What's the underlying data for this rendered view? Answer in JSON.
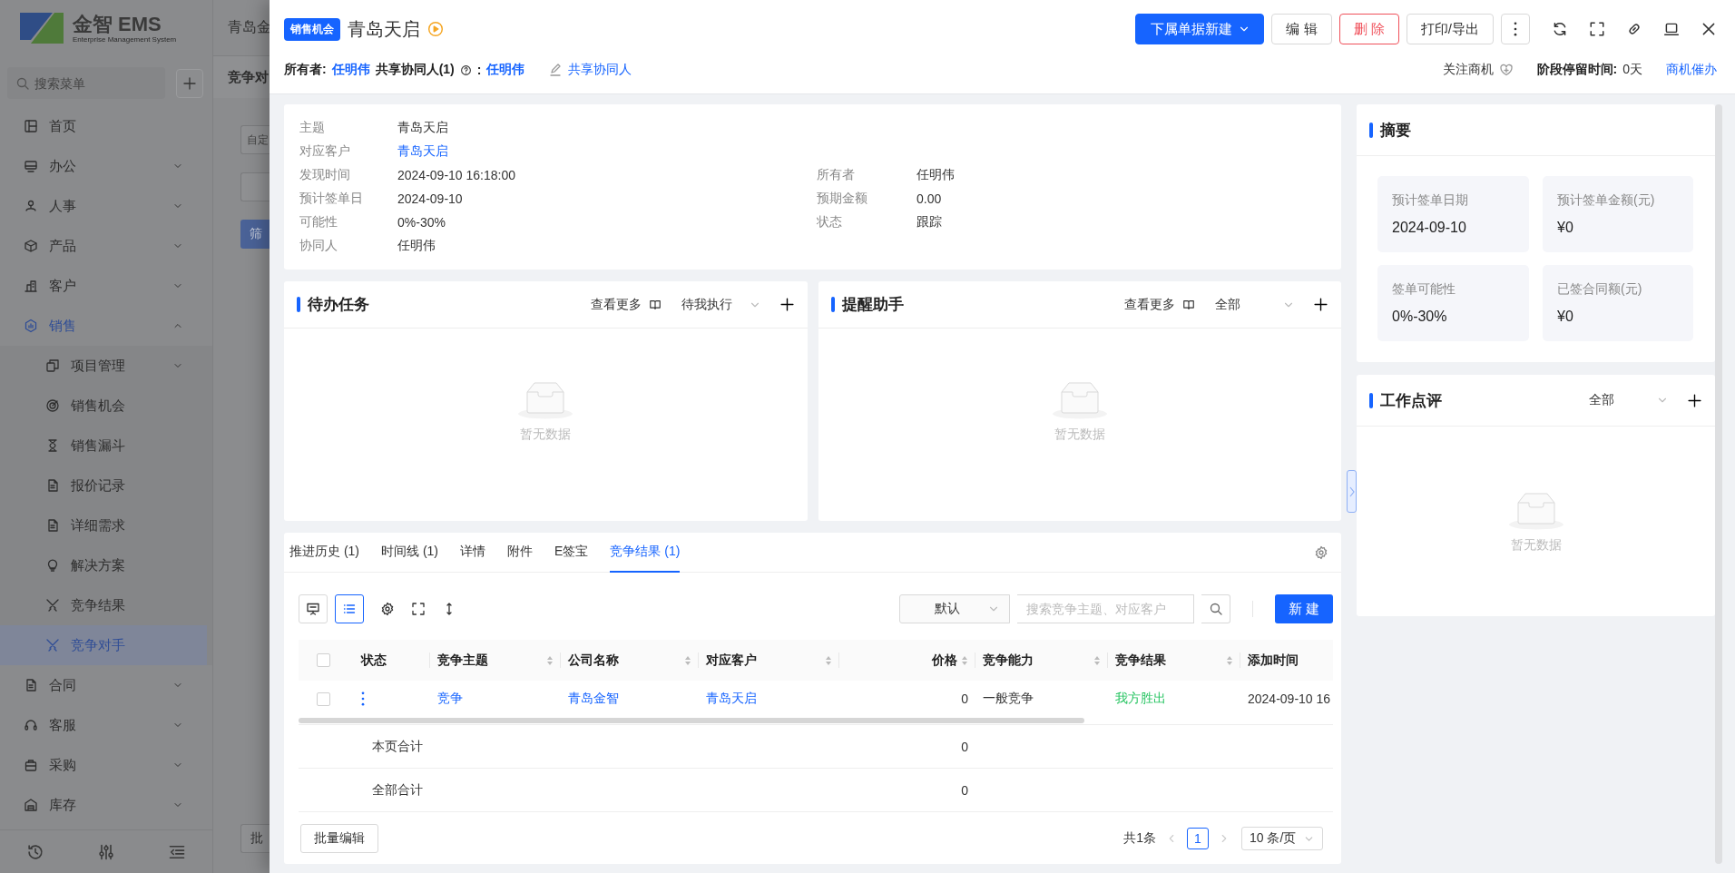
{
  "background": {
    "logo": {
      "name": "金智 EMS",
      "tagline": "Enterprise Management System"
    },
    "search": {
      "placeholder": "搜索菜单"
    },
    "menu": [
      {
        "label": "首页",
        "selected": false
      },
      {
        "label": "办公",
        "selected": false,
        "expanded": false
      },
      {
        "label": "人事",
        "selected": false,
        "expanded": false
      },
      {
        "label": "产品",
        "selected": false,
        "expanded": false
      },
      {
        "label": "客户",
        "selected": false,
        "expanded": false
      },
      {
        "label": "销售",
        "selected": true,
        "expanded": true,
        "children": [
          {
            "label": "项目管理",
            "selected": false,
            "expanded": false
          },
          {
            "label": "销售机会",
            "selected": false
          },
          {
            "label": "销售漏斗",
            "selected": false
          },
          {
            "label": "报价记录",
            "selected": false
          },
          {
            "label": "详细需求",
            "selected": false
          },
          {
            "label": "解决方案",
            "selected": false
          },
          {
            "label": "竞争结果",
            "selected": false
          },
          {
            "label": "竞争对手",
            "selected": true
          }
        ]
      },
      {
        "label": "合同",
        "selected": false,
        "expanded": false
      },
      {
        "label": "客服",
        "selected": false,
        "expanded": false
      },
      {
        "label": "采购",
        "selected": false,
        "expanded": false
      },
      {
        "label": "库存",
        "selected": false,
        "expanded": false
      }
    ],
    "page": {
      "title": "青岛金",
      "tab": "竞争对",
      "filter_placeholder": "自定",
      "filter_button": "筛",
      "batch_button": "批"
    }
  },
  "drawer": {
    "header": {
      "tag": "销售机会",
      "title": "青岛天启",
      "buttons": [
        {
          "kind": "primary-dropdown",
          "label": "下属单据新建"
        },
        {
          "kind": "default",
          "label": "编 辑"
        },
        {
          "kind": "danger",
          "label": "删 除"
        },
        {
          "kind": "default",
          "label": "打印/导出"
        },
        {
          "kind": "more"
        }
      ],
      "owner_label": "所有者:",
      "owner": "任明伟",
      "shared_label": "共享协同人(1)",
      "shared_colon": ":",
      "shared_value": "任明伟",
      "share_link": "共享协同人",
      "follow": "关注商机",
      "stay_label": "阶段停留时间:",
      "stay_value": "0天",
      "urge_link": "商机催办"
    },
    "info": {
      "rows": [
        {
          "left": {
            "label": "主题",
            "value": "青岛天启",
            "kind": "text"
          }
        },
        {
          "left": {
            "label": "对应客户",
            "value": "青岛天启",
            "kind": "link"
          }
        },
        {
          "left": {
            "label": "发现时间",
            "value": "2024-09-10 16:18:00",
            "kind": "text"
          },
          "right": {
            "label": "所有者",
            "value": "任明伟",
            "kind": "text"
          }
        },
        {
          "left": {
            "label": "预计签单日",
            "value": "2024-09-10",
            "kind": "text"
          },
          "right": {
            "label": "预期金额",
            "value": "0.00",
            "kind": "text"
          }
        },
        {
          "left": {
            "label": "可能性",
            "value": "0%-30%",
            "kind": "text"
          },
          "right": {
            "label": "状态",
            "value": "跟踪",
            "kind": "text"
          }
        },
        {
          "left": {
            "label": "协同人",
            "value": "任明伟",
            "kind": "text"
          }
        }
      ]
    },
    "todo": {
      "title": "待办任务",
      "more": "查看更多",
      "filter": "待我执行",
      "empty": "暂无数据"
    },
    "reminders": {
      "title": "提醒助手",
      "more": "查看更多",
      "filter": "全部",
      "empty": "暂无数据"
    },
    "summary": {
      "title": "摘要",
      "stats": [
        {
          "label": "预计签单日期",
          "value": "2024-09-10"
        },
        {
          "label": "预计签单金额(元)",
          "value": "¥0"
        },
        {
          "label": "签单可能性",
          "value": "0%-30%"
        },
        {
          "label": "已签合同额(元)",
          "value": "¥0"
        }
      ]
    },
    "review": {
      "title": "工作点评",
      "filter": "全部",
      "empty": "暂无数据"
    },
    "records": {
      "tabs": [
        {
          "label": "推进历史 (1)",
          "selected": false
        },
        {
          "label": "时间线 (1)",
          "selected": false
        },
        {
          "label": "详情",
          "selected": false
        },
        {
          "label": "附件",
          "selected": false
        },
        {
          "label": "E签宝",
          "selected": false
        },
        {
          "label": "竞争结果 (1)",
          "selected": true
        }
      ],
      "views": [
        {
          "selected": false
        },
        {
          "selected": true
        }
      ],
      "sort_select": "默认",
      "search": {
        "placeholder": "搜索竞争主题、对应客户"
      },
      "new_button": "新 建",
      "columns": [
        {
          "kind": "checkbox",
          "checked": false
        },
        {
          "kind": "text",
          "label": "状态",
          "sortable": false
        },
        {
          "kind": "text",
          "label": "竞争主题",
          "sortable": true
        },
        {
          "kind": "text",
          "label": "公司名称",
          "sortable": true
        },
        {
          "kind": "text",
          "label": "对应客户",
          "sortable": true
        },
        {
          "kind": "number",
          "label": "价格",
          "sortable": true
        },
        {
          "kind": "text",
          "label": "竞争能力",
          "sortable": true
        },
        {
          "kind": "text",
          "label": "竞争结果",
          "sortable": true
        },
        {
          "kind": "text",
          "label": "添加时间",
          "sortable": false
        }
      ],
      "rows": [
        {
          "cells": [
            {
              "kind": "checkbox",
              "checked": false
            },
            {
              "kind": "menu"
            },
            {
              "kind": "link",
              "text": "竞争"
            },
            {
              "kind": "link",
              "text": "青岛金智"
            },
            {
              "kind": "link",
              "text": "青岛天启"
            },
            {
              "kind": "number",
              "text": "0"
            },
            {
              "kind": "text",
              "text": "一般竞争"
            },
            {
              "kind": "result",
              "text": "我方胜出"
            },
            {
              "kind": "text",
              "text": "2024-09-10 16"
            }
          ]
        }
      ],
      "totals": [
        {
          "label": "本页合计",
          "price": "0"
        },
        {
          "label": "全部合计",
          "price": "0"
        }
      ],
      "batch_button": "批量编辑",
      "total": "共1条",
      "pages": [
        {
          "label": "1",
          "selected": true
        }
      ],
      "page_size": "10 条/页"
    }
  }
}
